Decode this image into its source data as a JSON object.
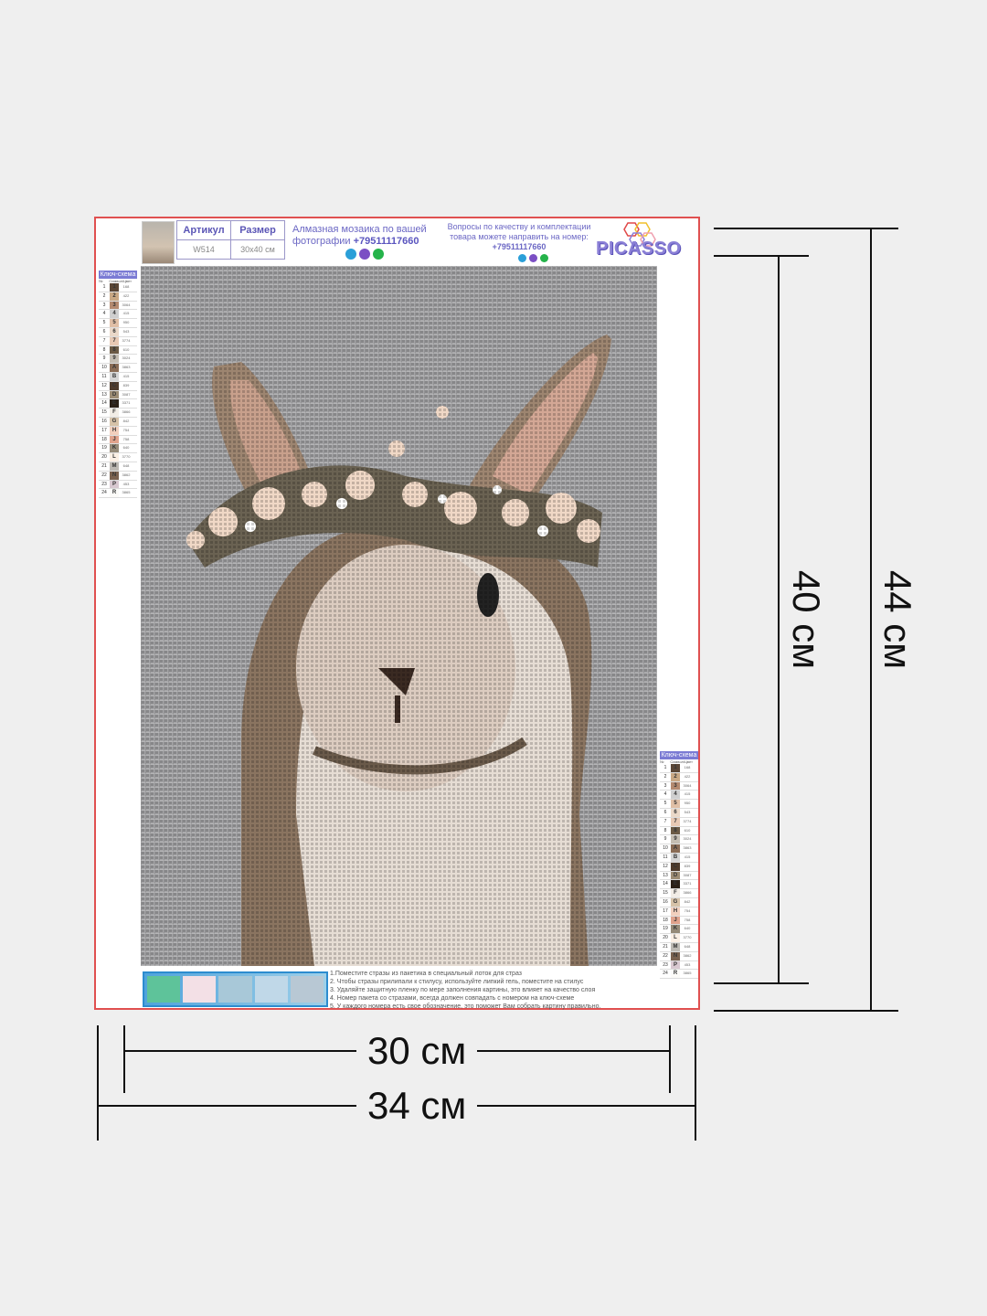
{
  "info_table": {
    "article_label": "Артикул",
    "size_label": "Размер",
    "article_value": "W514",
    "size_value": "30x40 см"
  },
  "promo": {
    "text": "Алмазная мозаика по вашей фотографии",
    "phone": "+79511117660"
  },
  "quality": {
    "text": "Вопросы по качеству и комплектации товара можете направить на номер:",
    "phone": "+79511117660"
  },
  "logo": {
    "text": "PICASSO"
  },
  "key_scheme": {
    "title": "Ключ-схема",
    "sub_no": "№",
    "sub_code": "Символ/Цвет",
    "rows": [
      {
        "n": "1",
        "s": "1",
        "c": "168",
        "color": "#5a4636"
      },
      {
        "n": "2",
        "s": "2",
        "c": "422",
        "color": "#c9a884"
      },
      {
        "n": "3",
        "s": "3",
        "c": "3064",
        "color": "#b48a70"
      },
      {
        "n": "4",
        "s": "4",
        "c": "415",
        "color": "#cfcfcf"
      },
      {
        "n": "5",
        "s": "5",
        "c": "950",
        "color": "#e0bfa6"
      },
      {
        "n": "6",
        "s": "6",
        "c": "543",
        "color": "#ead8c8"
      },
      {
        "n": "7",
        "s": "7",
        "c": "3774",
        "color": "#e8c9b4"
      },
      {
        "n": "8",
        "s": "8",
        "c": "610",
        "color": "#6b5a45"
      },
      {
        "n": "9",
        "s": "9",
        "c": "3024",
        "color": "#c4bdb2"
      },
      {
        "n": "10",
        "s": "A",
        "c": "3863",
        "color": "#8a6c55"
      },
      {
        "n": "11",
        "s": "B",
        "c": "415",
        "color": "#d4d4d4"
      },
      {
        "n": "12",
        "s": "C",
        "c": "839",
        "color": "#4e3b2c"
      },
      {
        "n": "13",
        "s": "D",
        "c": "3087",
        "color": "#9c8c74"
      },
      {
        "n": "14",
        "s": "E",
        "c": "3371",
        "color": "#2b2118"
      },
      {
        "n": "15",
        "s": "F",
        "c": "3866",
        "color": "#f2ede6"
      },
      {
        "n": "16",
        "s": "G",
        "c": "842",
        "color": "#d6c2a8"
      },
      {
        "n": "17",
        "s": "H",
        "c": "754",
        "color": "#f2cfbd"
      },
      {
        "n": "18",
        "s": "J",
        "c": "758",
        "color": "#e0a28c"
      },
      {
        "n": "19",
        "s": "K",
        "c": "640",
        "color": "#958a78"
      },
      {
        "n": "20",
        "s": "L",
        "c": "3770",
        "color": "#fbefe4"
      },
      {
        "n": "21",
        "s": "M",
        "c": "648",
        "color": "#bcb8b2"
      },
      {
        "n": "22",
        "s": "N",
        "c": "3862",
        "color": "#7a6250"
      },
      {
        "n": "23",
        "s": "P",
        "c": "453",
        "color": "#d8c8d0"
      },
      {
        "n": "24",
        "s": "R",
        "c": "3865",
        "color": "#fcfbf8"
      }
    ]
  },
  "instructions": [
    "1.Поместите стразы из пакетика в специальный лоток для страз",
    "2. Чтобы стразы прилипали к стилусу, используйте липкий гель, поместите на стилус",
    "3. Удаляйте защитную пленку по мере заполнения картины, это влияет на качество слоя",
    "4. Номер пакета со стразами, всегда должен совпадать с номером  на ключ-схеме",
    "5. У каждого номера есть свое обозначение, это поможет Вам собрать картину правильно."
  ],
  "dimensions": {
    "inner_width": "30 см",
    "outer_width": "34 см",
    "inner_height": "40 см",
    "outer_height": "44 см"
  },
  "colors": {
    "frame": "#e05050",
    "accent": "#6b67c4",
    "background": "#efefef"
  }
}
